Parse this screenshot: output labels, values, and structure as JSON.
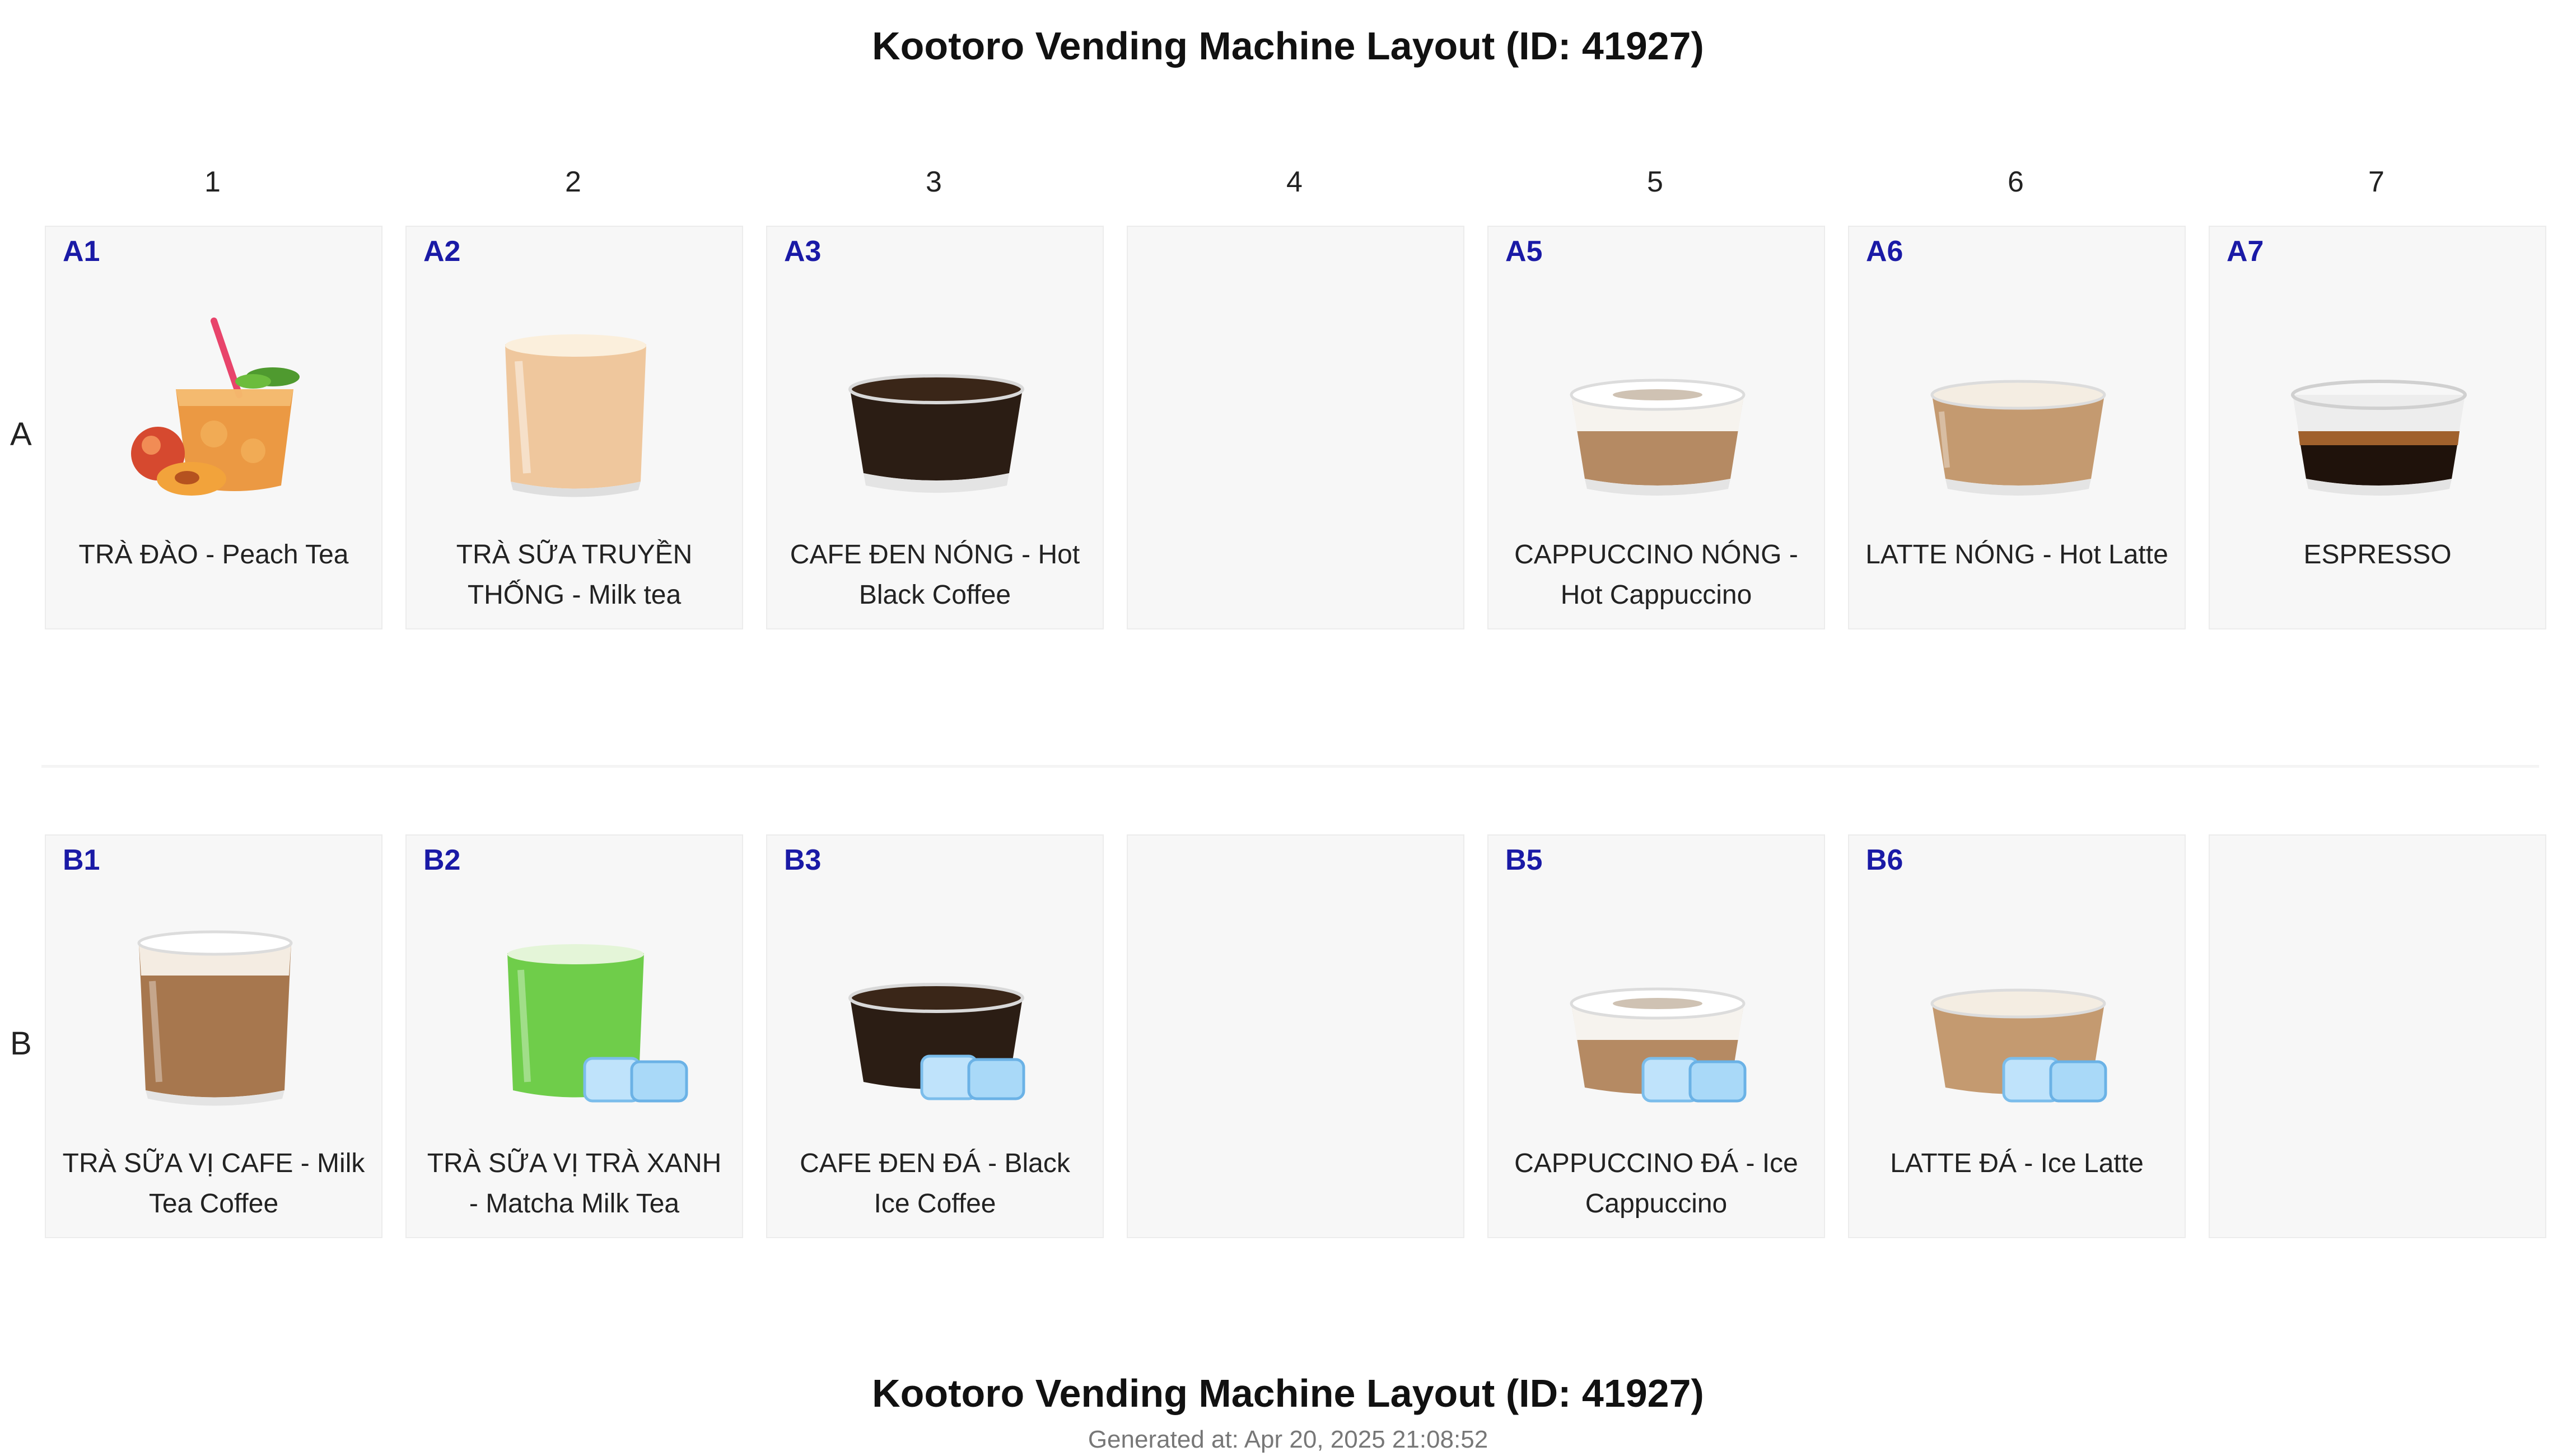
{
  "title": "Kootoro Vending Machine Layout (ID: 41927)",
  "footer": {
    "title": "Kootoro Vending Machine Layout (ID: 41927)",
    "generated": "Generated at: Apr 20, 2025 21:08:52"
  },
  "columns": [
    "1",
    "2",
    "3",
    "4",
    "5",
    "6",
    "7"
  ],
  "rows": [
    {
      "label": "A",
      "slots": [
        {
          "code": "A1",
          "name": "TRÀ ĐÀO - Peach Tea",
          "icon": "peach-tea-icon"
        },
        {
          "code": "A2",
          "name": "TRÀ SỮA TRUYỀN THỐNG - Milk tea",
          "icon": "milk-tea-icon"
        },
        {
          "code": "A3",
          "name": "CAFE ĐEN NÓNG - Hot Black Coffee",
          "icon": "hot-black-coffee-icon"
        },
        {
          "code": "",
          "name": "",
          "icon": ""
        },
        {
          "code": "A5",
          "name": "CAPPUCCINO NÓNG - Hot Cappuccino",
          "icon": "hot-cappuccino-icon"
        },
        {
          "code": "A6",
          "name": "LATTE NÓNG - Hot Latte",
          "icon": "hot-latte-icon"
        },
        {
          "code": "A7",
          "name": "ESPRESSO",
          "icon": "espresso-icon"
        }
      ]
    },
    {
      "label": "B",
      "slots": [
        {
          "code": "B1",
          "name": "TRÀ SỮA VỊ CAFE - Milk Tea Coffee",
          "icon": "milk-tea-coffee-icon"
        },
        {
          "code": "B2",
          "name": "TRÀ SỮA VỊ TRÀ XANH - Matcha Milk Tea",
          "icon": "matcha-milk-tea-icon"
        },
        {
          "code": "B3",
          "name": "CAFE ĐEN ĐÁ - Black Ice Coffee",
          "icon": "iced-black-coffee-icon"
        },
        {
          "code": "",
          "name": "",
          "icon": ""
        },
        {
          "code": "B5",
          "name": "CAPPUCCINO ĐÁ - Ice Cappuccino",
          "icon": "iced-cappuccino-icon"
        },
        {
          "code": "B6",
          "name": "LATTE ĐÁ - Ice Latte",
          "icon": "iced-latte-icon"
        },
        {
          "code": "",
          "name": "",
          "icon": ""
        }
      ]
    }
  ],
  "colors": {
    "slot_code": "#1a1aa6",
    "slot_bg": "#f7f7f7",
    "generated_text": "#777777"
  }
}
